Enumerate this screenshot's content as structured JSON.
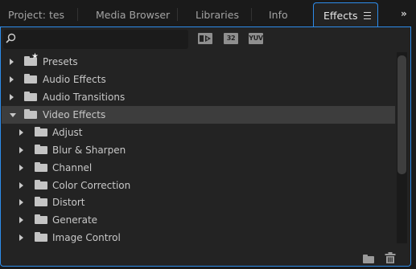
{
  "tabs": {
    "project": "Project: tes",
    "media_browser": "Media Browser",
    "libraries": "Libraries",
    "info": "Info",
    "effects": "Effects",
    "overflow": "»"
  },
  "toolbar": {
    "search_value": "",
    "accelerated_label": "▶",
    "bit32_label": "32",
    "yuv_label": "YUV"
  },
  "tree": [
    {
      "label": "Presets",
      "level": 0,
      "expanded": false,
      "icon": "preset-folder-icon"
    },
    {
      "label": "Audio Effects",
      "level": 0,
      "expanded": false,
      "icon": "folder-icon"
    },
    {
      "label": "Audio Transitions",
      "level": 0,
      "expanded": false,
      "icon": "folder-icon"
    },
    {
      "label": "Video Effects",
      "level": 0,
      "expanded": true,
      "selected": true,
      "icon": "folder-icon"
    },
    {
      "label": "Adjust",
      "level": 1,
      "expanded": false,
      "icon": "folder-icon"
    },
    {
      "label": "Blur & Sharpen",
      "level": 1,
      "expanded": false,
      "icon": "folder-icon"
    },
    {
      "label": "Channel",
      "level": 1,
      "expanded": false,
      "icon": "folder-icon"
    },
    {
      "label": "Color Correction",
      "level": 1,
      "expanded": false,
      "icon": "folder-icon"
    },
    {
      "label": "Distort",
      "level": 1,
      "expanded": false,
      "icon": "folder-icon"
    },
    {
      "label": "Generate",
      "level": 1,
      "expanded": false,
      "icon": "folder-icon"
    },
    {
      "label": "Image Control",
      "level": 1,
      "expanded": false,
      "icon": "folder-icon"
    }
  ],
  "bottom": {
    "new_bin_icon": "new-bin-icon",
    "delete_icon": "trash-icon"
  },
  "colors": {
    "accent": "#2d8ceb",
    "panel_bg": "#232323",
    "selected_row": "#3d3d3d"
  }
}
